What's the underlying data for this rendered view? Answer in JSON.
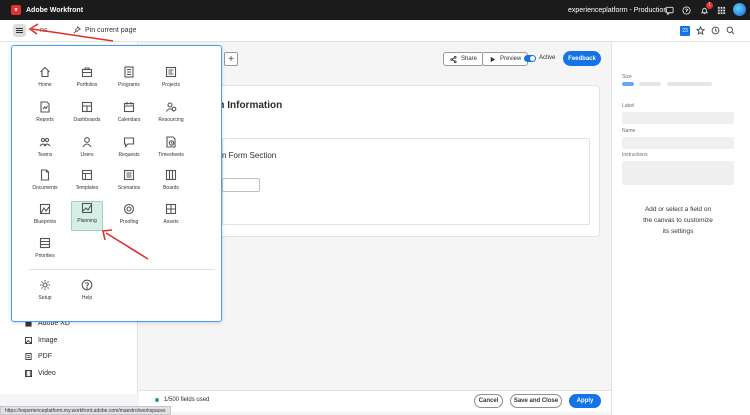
{
  "topbar": {
    "app_name": "Adobe Workfront",
    "environment": "experienceplatform - Production",
    "notification_count": "1",
    "brand_color": "#e0312d"
  },
  "subbar": {
    "crumb": "ns",
    "pin_label": "Pin current page",
    "calendar_day": "23"
  },
  "menu": {
    "items": [
      {
        "label": "Home",
        "icon": "home-icon"
      },
      {
        "label": "Portfolios",
        "icon": "briefcase-icon"
      },
      {
        "label": "Programs",
        "icon": "programs-icon"
      },
      {
        "label": "Projects",
        "icon": "projects-icon"
      },
      {
        "label": "Reports",
        "icon": "reports-icon"
      },
      {
        "label": "Dashboards",
        "icon": "dashboards-icon"
      },
      {
        "label": "Calendars",
        "icon": "calendar-icon"
      },
      {
        "label": "Resourcing",
        "icon": "resourcing-icon"
      },
      {
        "label": "Teams",
        "icon": "teams-icon"
      },
      {
        "label": "Users",
        "icon": "user-icon"
      },
      {
        "label": "Requests",
        "icon": "requests-icon"
      },
      {
        "label": "Timesheets",
        "icon": "timesheets-icon"
      },
      {
        "label": "Documents",
        "icon": "document-icon"
      },
      {
        "label": "Templates",
        "icon": "templates-icon"
      },
      {
        "label": "Scenarios",
        "icon": "scenarios-icon"
      },
      {
        "label": "Boards",
        "icon": "boards-icon"
      },
      {
        "label": "Blueprints",
        "icon": "blueprints-icon"
      },
      {
        "label": "Planning",
        "icon": "planning-icon"
      },
      {
        "label": "Proofing",
        "icon": "proofing-icon"
      },
      {
        "label": "Assets",
        "icon": "assets-icon"
      },
      {
        "label": "Priorities",
        "icon": "priorities-icon"
      },
      {
        "label": "Setup",
        "icon": "gear-icon"
      },
      {
        "label": "Help",
        "icon": "help-icon"
      }
    ]
  },
  "leftpanel": {
    "items": [
      "Adobe XD",
      "Image",
      "PDF",
      "Video"
    ]
  },
  "toolbar": {
    "share": "Share",
    "preview": "Preview",
    "active": "Active",
    "feedback": "Feedback"
  },
  "canvas": {
    "title": "gram Information",
    "section_title": "n Form Section"
  },
  "rightpanel": {
    "size_label": "Size",
    "label_label": "Label",
    "name_label": "Name",
    "instructions_label": "Instructions",
    "hint": "Add or select a field on the canvas to customize its settings"
  },
  "footer": {
    "fields_used": "1/500 fields used",
    "cancel": "Cancel",
    "save_close": "Save and Close",
    "apply": "Apply"
  },
  "status_url": "https://experienceplatform.my.workfront.adobe.com/maestro/workspaces",
  "colors": {
    "accent": "#1473e6",
    "highlight": "#d5efe6",
    "annotation_arrow": "#e0312d"
  }
}
